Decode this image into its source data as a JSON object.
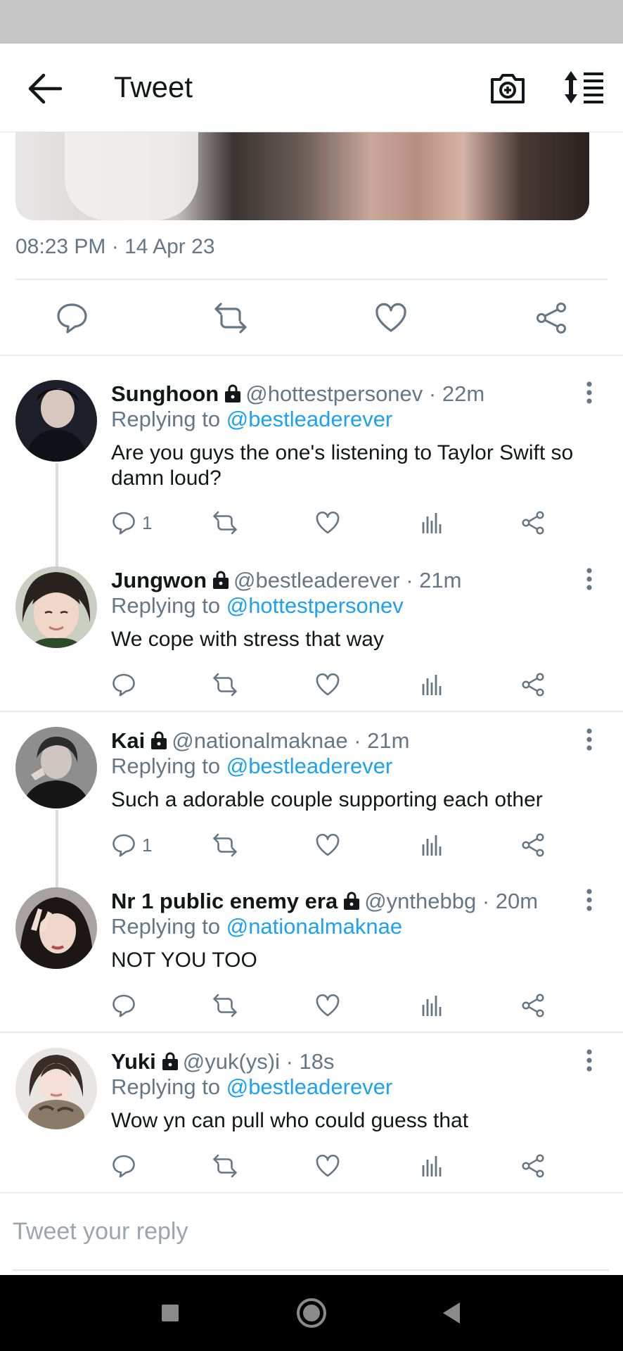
{
  "app_bar": {
    "title": "Tweet",
    "back_icon": "arrow-left-icon",
    "camera_icon": "camera-plus-icon",
    "sort_icon": "sort-icon"
  },
  "tweet": {
    "timestamp": "08:23 PM · 14 Apr 23"
  },
  "colors": {
    "accent": "#1da1f2",
    "muted": "#657786",
    "text": "#14171a",
    "divider": "#e6ecf0"
  },
  "replies": [
    {
      "name": "Sunghoon",
      "handle": "@hottestpersonev · 22m",
      "replying_label": "Replying to",
      "replying_to": "@bestleaderever",
      "text": "Are you guys the one's listening to Taylor Swift so damn loud?",
      "reply_count": "1"
    },
    {
      "name": "Jungwon",
      "handle": "@bestleaderever · 21m",
      "replying_label": "Replying to",
      "replying_to": "@hottestpersonev",
      "text": "We cope with stress that way",
      "reply_count": ""
    },
    {
      "name": "Kai",
      "handle": "@nationalmaknae · 21m",
      "replying_label": "Replying to",
      "replying_to": "@bestleaderever",
      "text": "Such a adorable couple supporting each other",
      "reply_count": "1"
    },
    {
      "name": "Nr 1 public enemy era",
      "handle": "@ynthebbg · 20m",
      "replying_label": "Replying to",
      "replying_to": "@nationalmaknae",
      "text": "NOT YOU TOO",
      "reply_count": ""
    },
    {
      "name": "Yuki",
      "handle": "@yuk(ys)i · 18s",
      "replying_label": "Replying to",
      "replying_to": "@bestleaderever",
      "text": "Wow yn can pull who could guess that",
      "reply_count": ""
    }
  ],
  "compose": {
    "placeholder": "Tweet your reply"
  }
}
